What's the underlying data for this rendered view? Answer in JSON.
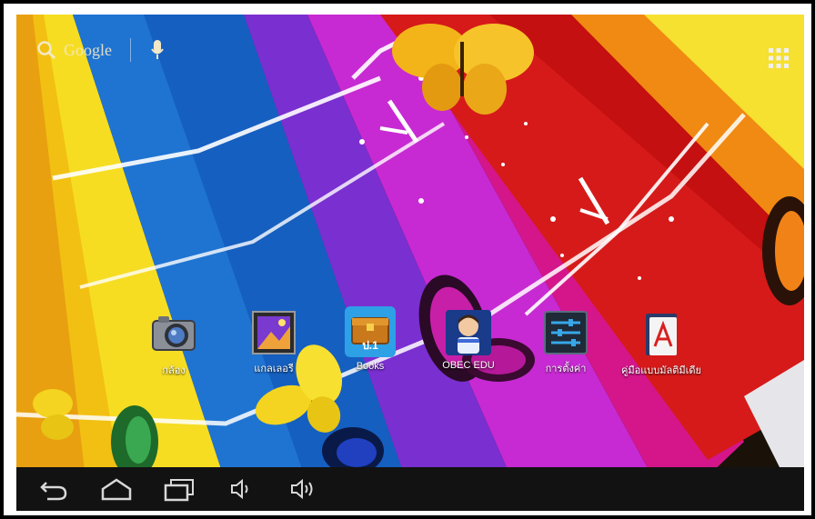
{
  "search": {
    "label": "Google"
  },
  "apps": [
    {
      "label": "กล้อง",
      "icon": "camera-icon"
    },
    {
      "label": "แกลเลอรี",
      "icon": "gallery-icon"
    },
    {
      "label": "Books",
      "icon": "books-icon"
    },
    {
      "label": "OBEC EDU",
      "icon": "obec-edu-icon"
    },
    {
      "label": "การตั้งค่า",
      "icon": "settings-icon"
    },
    {
      "label": "คู่มือแบบมัลติมีเดีย",
      "icon": "pdf-manual-icon"
    }
  ],
  "books_icon_text": "ป.1",
  "navbar": {
    "buttons": [
      "back-icon",
      "home-icon",
      "recent-apps-icon",
      "volume-down-icon",
      "volume-up-icon"
    ]
  },
  "colors": {
    "navbar": "#121212",
    "label": "#ffffff"
  }
}
